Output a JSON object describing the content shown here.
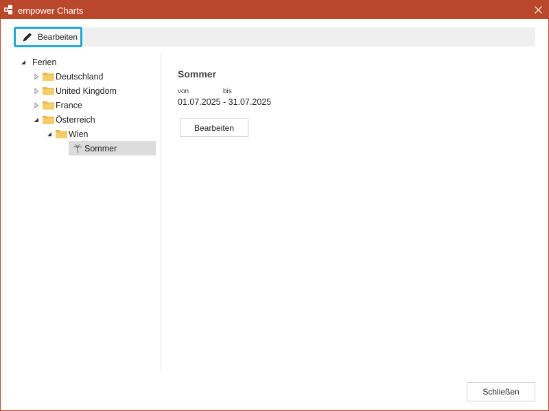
{
  "window": {
    "title": "empower Charts",
    "accent_color": "#b9472b",
    "highlight_color": "#1fa8d6"
  },
  "toolbar": {
    "edit_label": "Bearbeiten",
    "edit_icon": "pencil-icon"
  },
  "tree": {
    "root": "Ferien",
    "deutschland": "Deutschland",
    "uk": "United Kingdom",
    "france": "France",
    "oesterreich": "Österreich",
    "wien": "Wien",
    "sommer": "Sommer"
  },
  "detail": {
    "title": "Sommer",
    "from_label": "von",
    "to_label": "bis",
    "date_range": "01.07.2025 - 31.07.2025",
    "edit_button": "Bearbeiten"
  },
  "footer": {
    "close_button": "Schließen"
  }
}
